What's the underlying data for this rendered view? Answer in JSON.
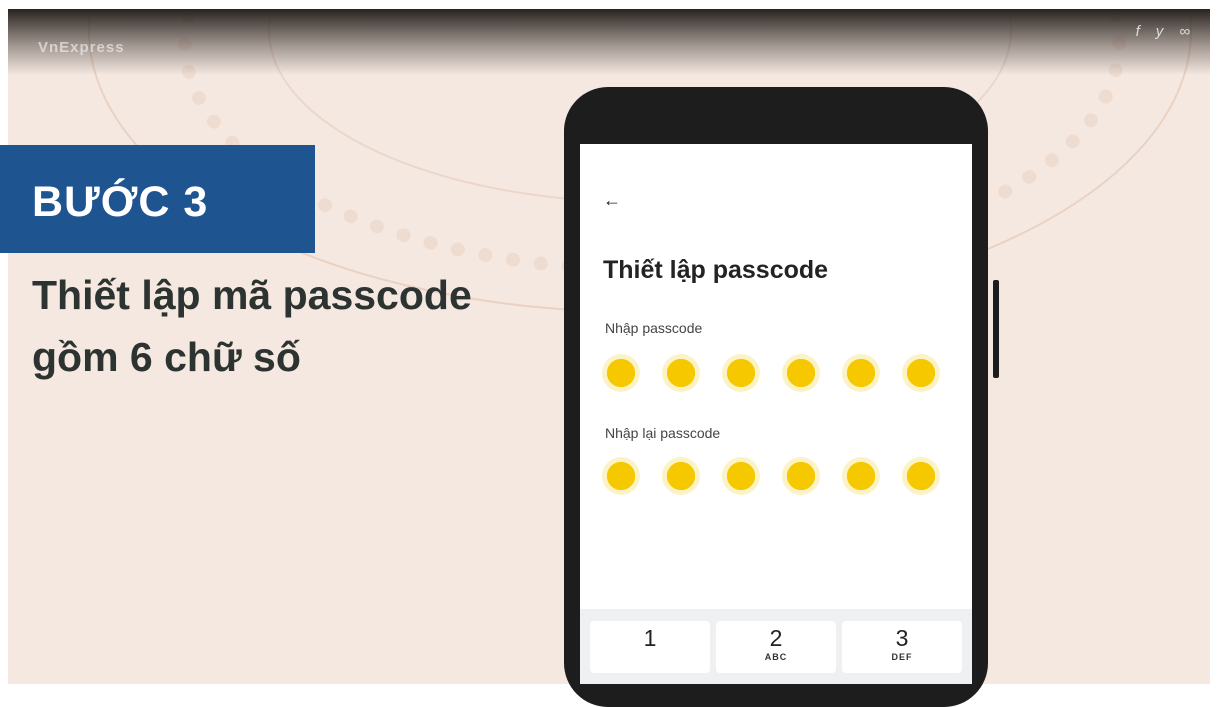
{
  "brand": "VnExpress",
  "share": [
    "f",
    "y",
    "∞"
  ],
  "step": {
    "label": "BƯỚC 3",
    "description": "Thiết lập mã passcode gồm 6 chữ số"
  },
  "screen": {
    "back_icon": "←",
    "title": "Thiết lập passcode",
    "enter_label": "Nhập passcode",
    "reenter_label": "Nhập lại passcode",
    "dot_count": 6,
    "keys": [
      {
        "num": "1",
        "sub": ""
      },
      {
        "num": "2",
        "sub": "ABC"
      },
      {
        "num": "3",
        "sub": "DEF"
      }
    ]
  },
  "colors": {
    "step_box": "#1e548f",
    "dot": "#f6c800",
    "background": "#f4e8e1"
  }
}
